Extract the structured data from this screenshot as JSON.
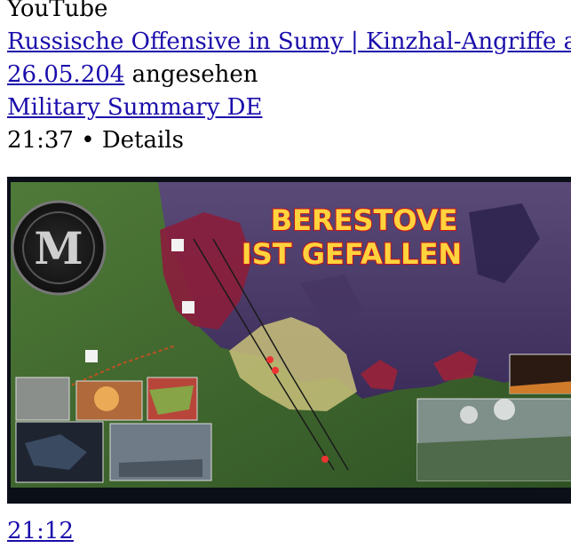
{
  "history_entry": {
    "source": "YouTube",
    "video_title": "Russische Offensive in Sumy | Kinzhal-Angriffe a",
    "watched_date": "26.05.204",
    "watched_suffix": " angesehen",
    "channel": "Military Summary DE",
    "duration": "21:37",
    "separator": " • ",
    "details_label": "Details",
    "thumbnail": {
      "headline_line1": "BERESTOVE",
      "headline_line2": "IST GEFALLEN",
      "logo_letter": "M"
    },
    "next_duration": "21:12"
  },
  "colors": {
    "link": "#1a0dab",
    "headline_fill": "#ffd33d",
    "headline_stroke": "#c8121c",
    "occupied_zone": "#8a1e3c",
    "contested_zone": "#c9c17a",
    "map_green": "#3e6a2c",
    "map_purple": "#4c3a6c"
  }
}
